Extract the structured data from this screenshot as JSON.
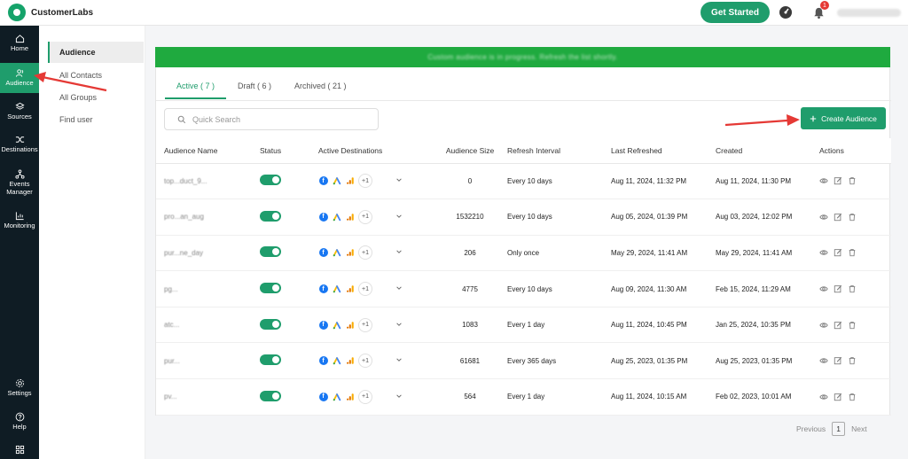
{
  "app": {
    "brand": "CustomerLabs",
    "get_started": "Get Started",
    "notification_count": "1"
  },
  "sidebar": {
    "items": [
      {
        "label": "Home",
        "icon": "home-icon"
      },
      {
        "label": "Audience",
        "icon": "users-icon"
      },
      {
        "label": "Sources",
        "icon": "layers-icon"
      },
      {
        "label": "Destinations",
        "icon": "shuffle-icon"
      },
      {
        "label": "Events Manager",
        "icon": "nodes-icon"
      },
      {
        "label": "Monitoring",
        "icon": "chart-icon"
      },
      {
        "label": "Settings",
        "icon": "gear-icon"
      },
      {
        "label": "Help",
        "icon": "help-icon"
      }
    ]
  },
  "subnav": {
    "items": [
      "Audience",
      "All Contacts",
      "All Groups",
      "Find user"
    ]
  },
  "banner": {
    "text": "Custom audience is in progress. Refresh the list shortly."
  },
  "tabs": [
    "Active ( 7 )",
    "Draft ( 6 )",
    "Archived ( 21 )"
  ],
  "search": {
    "placeholder": "Quick Search"
  },
  "create_button": "Create Audience",
  "table": {
    "headers": [
      "Audience Name",
      "Status",
      "Active Destinations",
      "Audience Size",
      "Refresh Interval",
      "Last Refreshed",
      "Created",
      "Actions"
    ],
    "rows": [
      {
        "name": "top...duct_9...",
        "more": "+1",
        "size": "0",
        "refresh": "Every 10 days",
        "last": "Aug 11, 2024, 11:32 PM",
        "created": "Aug 11, 2024, 11:30 PM"
      },
      {
        "name": "pro...an_aug",
        "more": "+1",
        "size": "1532210",
        "refresh": "Every 10 days",
        "last": "Aug 05, 2024, 01:39 PM",
        "created": "Aug 03, 2024, 12:02 PM"
      },
      {
        "name": "pur...ne_day",
        "more": "+1",
        "size": "206",
        "refresh": "Only once",
        "last": "May 29, 2024, 11:41 AM",
        "created": "May 29, 2024, 11:41 AM"
      },
      {
        "name": "pg...",
        "more": "+1",
        "size": "4775",
        "refresh": "Every 10 days",
        "last": "Aug 09, 2024, 11:30 AM",
        "created": "Feb 15, 2024, 11:29 AM"
      },
      {
        "name": "atc...",
        "more": "+1",
        "size": "1083",
        "refresh": "Every 1 day",
        "last": "Aug 11, 2024, 10:45 PM",
        "created": "Jan 25, 2024, 10:35 PM"
      },
      {
        "name": "pur...",
        "more": "+1",
        "size": "61681",
        "refresh": "Every 365 days",
        "last": "Aug 25, 2023, 01:35 PM",
        "created": "Aug 25, 2023, 01:35 PM"
      },
      {
        "name": "pv...",
        "more": "+1",
        "size": "564",
        "refresh": "Every 1 day",
        "last": "Aug 11, 2024, 10:15 AM",
        "created": "Feb 02, 2023, 10:01 AM"
      }
    ]
  },
  "pager": {
    "previous": "Previous",
    "page": "1",
    "next": "Next"
  },
  "colors": {
    "brand": "#1f9d6c",
    "sidebar": "#0f1c24",
    "banner": "#1faa3f",
    "annotation": "#e53935"
  }
}
